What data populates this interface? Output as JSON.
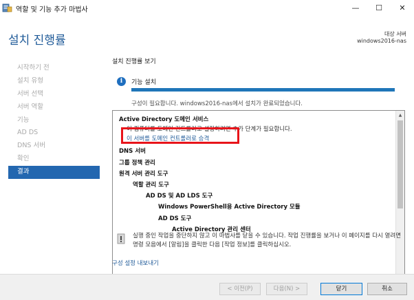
{
  "window": {
    "title": "역할 및 기능 추가 마법사",
    "minimize": "—",
    "maximize": "☐",
    "close": "✕"
  },
  "header": {
    "page_title": "설치 진행률",
    "target_label": "대상 서버",
    "target_name": "windows2016-nas"
  },
  "sidebar": {
    "items": [
      {
        "label": "시작하기 전"
      },
      {
        "label": "설치 유형"
      },
      {
        "label": "서버 선택"
      },
      {
        "label": "서버 역할"
      },
      {
        "label": "기능"
      },
      {
        "label": "AD DS"
      },
      {
        "label": "DNS 서버"
      },
      {
        "label": "확인"
      },
      {
        "label": "결과"
      }
    ],
    "active_index": 8
  },
  "main": {
    "section_title": "설치 진행률 보기",
    "install_label": "기능 설치",
    "progress_fraction": 1.0,
    "progress_message": "구성이 필요합니다. windows2016-nas에서 설치가 완료되었습니다.",
    "results": {
      "adds_title": "Active Directory 도메인 서비스",
      "adds_desc": "이 컴퓨터를 도메인 컨트롤러로 설정하려면 추가 단계가 필요합니다.",
      "promote_link": "이 서버를 도메인 컨트롤러로 승격",
      "dns": "DNS 서버",
      "gpm": "그룹 정책 관리",
      "rsat": "원격 서버 관리 도구",
      "role_tools": "역할 관리 도구",
      "adds_lds_tools": "AD DS 및 AD LDS 도구",
      "powershell": "Windows PowerShell용 Active Directory 모듈",
      "adds_tools": "AD DS 도구",
      "admin_center": "Active Directory 관리 센터"
    },
    "warning_text": "실행 중인 작업을 중단하지 않고 이 마법사를 닫을 수 있습니다. 작업 진행률을 보거나 이 페이지를 다시 열려면 명령 모음에서 [알림]을 클릭한 다음 [작업 정보]를 클릭하십시오.",
    "export_link": "구성 설정 내보내기"
  },
  "footer": {
    "prev": "< 이전(P)",
    "next": "다음(N) >",
    "close": "닫기",
    "cancel": "취소"
  },
  "colors": {
    "title_blue": "#1f5a98",
    "active_nav": "#2367b0",
    "progress": "#1f76b9",
    "highlight": "#e8141a"
  }
}
